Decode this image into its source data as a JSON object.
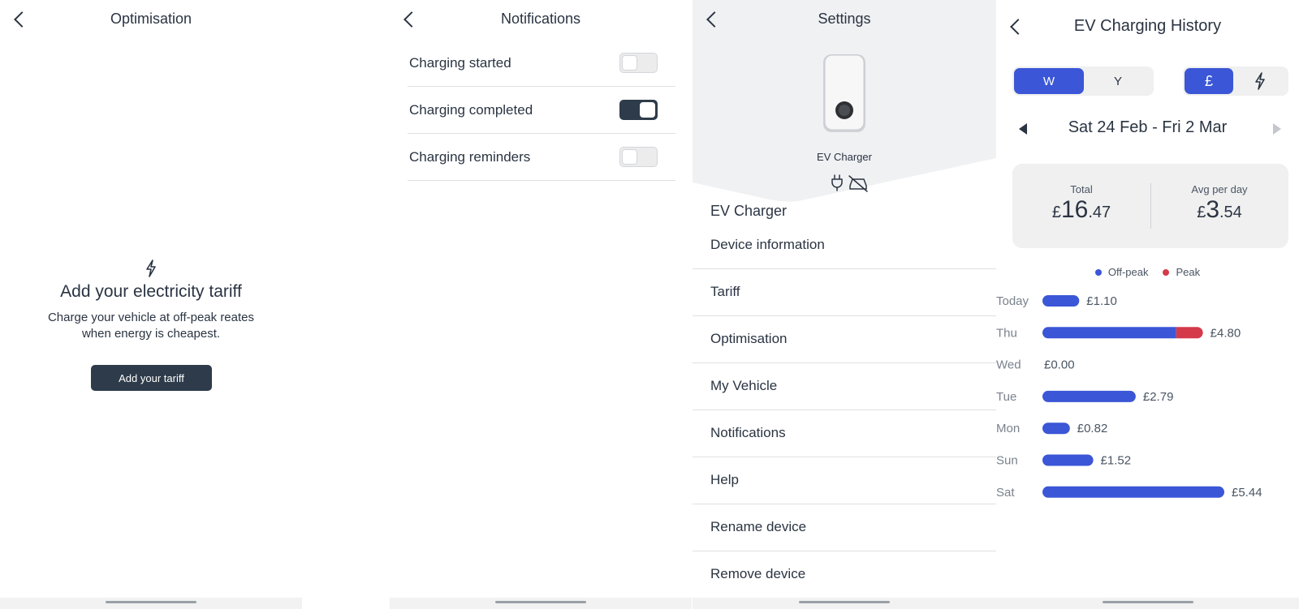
{
  "optimisation": {
    "title": "Optimisation",
    "headline": "Add your electricity tariff",
    "subtext": "Charge your vehicle at off-peak reates when energy is cheapest.",
    "cta_label": "Add your tariff"
  },
  "notifications": {
    "title": "Notifications",
    "items": [
      {
        "label": "Charging started",
        "enabled": false
      },
      {
        "label": "Charging completed",
        "enabled": true
      },
      {
        "label": "Charging reminders",
        "enabled": false
      }
    ]
  },
  "settings": {
    "title": "Settings",
    "device_name": "EV Charger",
    "section_title": "EV Charger",
    "items": [
      {
        "label": "Device information"
      },
      {
        "label": "Tariff"
      },
      {
        "label": "Optimisation"
      },
      {
        "label": "My Vehicle"
      },
      {
        "label": "Notifications"
      },
      {
        "label": "Help"
      },
      {
        "label": "Rename device"
      },
      {
        "label": "Remove device"
      }
    ]
  },
  "history": {
    "title": "EV Charging History",
    "period_options": [
      "W",
      "Y"
    ],
    "period_selected": "W",
    "unit_options": [
      "£",
      "bolt-icon"
    ],
    "unit_selected": "£",
    "date_range": "Sat 24 Feb - Fri 2 Mar",
    "total": {
      "label": "Total",
      "currency": "£",
      "whole": "16",
      "decimal": ".47"
    },
    "avg": {
      "label": "Avg per day",
      "currency": "£",
      "whole": "3",
      "decimal": ".54"
    },
    "legend": [
      {
        "label": "Off-peak",
        "color": "#3b56d6"
      },
      {
        "label": "Peak",
        "color": "#d43a4a"
      }
    ]
  },
  "chart_data": {
    "type": "bar",
    "orientation": "horizontal",
    "stacked": true,
    "categories": [
      "Today",
      "Thu",
      "Wed",
      "Tue",
      "Mon",
      "Sun",
      "Sat"
    ],
    "series": [
      {
        "name": "Off-peak",
        "color": "#3b56d6",
        "values": [
          1.1,
          4.0,
          0.0,
          2.79,
          0.82,
          1.52,
          5.44
        ]
      },
      {
        "name": "Peak",
        "color": "#d43a4a",
        "values": [
          0.0,
          0.8,
          0.0,
          0.0,
          0.0,
          0.0,
          0.0
        ]
      }
    ],
    "total_labels": [
      "£1.10",
      "£4.80",
      "£0.00",
      "£2.79",
      "£0.82",
      "£1.52",
      "£5.44"
    ],
    "xlim": [
      0,
      5.44
    ]
  }
}
